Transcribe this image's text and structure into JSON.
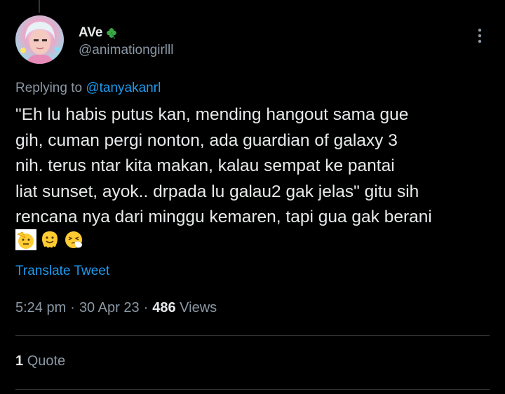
{
  "author": {
    "display_name": "AVe",
    "name_emoji": "clover-icon",
    "handle": "@animationgirlll"
  },
  "reply": {
    "prefix": "Replying to ",
    "mention": "@tanyakanrl"
  },
  "tweet": {
    "text": "\"Eh lu habis putus kan, mending hangout sama gue\ngih, cuman pergi nonton, ada guardian of galaxy 3\nnih. terus ntar kita makan, kalau sempat ke pantai\nliat sunset, ayok.. drpada lu galau2 gak jelas\" gitu sih\nrencana nya dari minggu kemaren, tapi gua gak berani",
    "emojis": [
      "saluting-face-icon",
      "melting-face-icon",
      "sneezing-face-icon"
    ]
  },
  "translate_label": "Translate Tweet",
  "meta": {
    "time": "5:24 pm",
    "sep1": "·",
    "date": "30 Apr 23",
    "sep2": "·",
    "views_count": "486",
    "views_label": "Views"
  },
  "stats": {
    "quote_count": "1",
    "quote_label": "Quote"
  },
  "colors": {
    "background": "#000000",
    "text": "#e7e9ea",
    "secondary": "#8b98a5",
    "link": "#1d9bf0",
    "divider": "#2f3336"
  }
}
